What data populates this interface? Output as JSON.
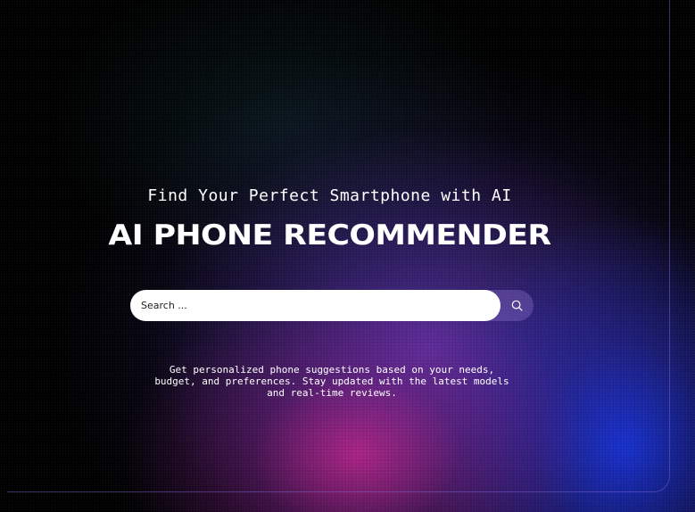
{
  "hero": {
    "tagline": "Find Your Perfect Smartphone with AI",
    "title": "AI PHONE RECOMMENDER",
    "description": "Get personalized phone suggestions based on your needs,\nbudget, and preferences. Stay updated with the latest models\nand real-time reviews."
  },
  "search": {
    "placeholder": "Search ...",
    "value": "",
    "button_icon": "search-icon"
  },
  "colors": {
    "background": "#000000",
    "glow_purple": "#5f37b9",
    "glow_pink": "#d62896",
    "glow_blue": "#1937eb",
    "text": "#ffffff"
  }
}
